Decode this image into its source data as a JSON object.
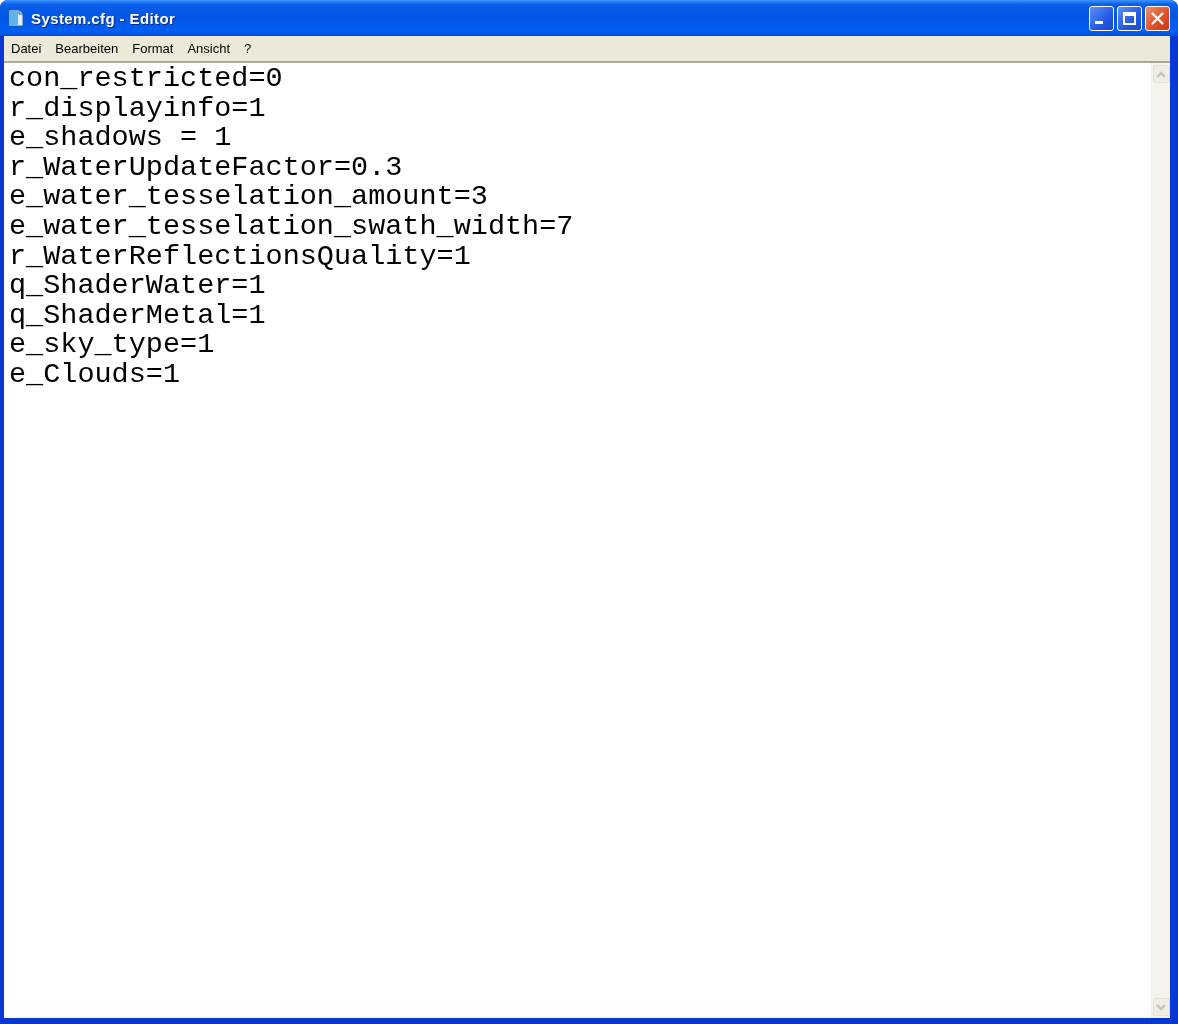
{
  "window": {
    "title": "System.cfg - Editor"
  },
  "menu": [
    {
      "label": "Datei"
    },
    {
      "label": "Bearbeiten"
    },
    {
      "label": "Format"
    },
    {
      "label": "Ansicht"
    },
    {
      "label": "?"
    }
  ],
  "document": {
    "lines": [
      "con_restricted=0",
      "r_displayinfo=1",
      "e_shadows = 1",
      "r_WaterUpdateFactor=0.3",
      "e_water_tesselation_amount=3",
      "e_water_tesselation_swath_width=7",
      "r_WaterReflectionsQuality=1",
      "q_ShaderWater=1",
      "q_ShaderMetal=1",
      "e_sky_type=1",
      "e_Clouds=1"
    ]
  },
  "scrollbar": {
    "disabled": true
  }
}
